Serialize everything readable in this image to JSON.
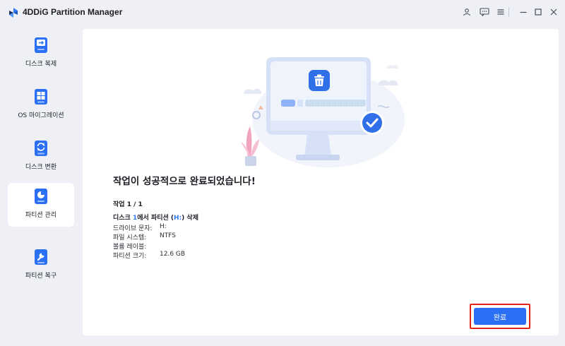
{
  "app": {
    "title": "4DDiG Partition Manager"
  },
  "titlebar": {
    "icons": [
      "user-icon",
      "feedback-icon",
      "menu-icon",
      "minimize-icon",
      "maximize-icon",
      "close-icon"
    ]
  },
  "sidebar": {
    "items": [
      {
        "label": "디스크 복제",
        "icon": "disk-clone-icon",
        "active": false
      },
      {
        "label": "OS 마이그레이션",
        "icon": "os-migration-icon",
        "active": false
      },
      {
        "label": "디스크 변환",
        "icon": "disk-convert-icon",
        "active": false
      },
      {
        "label": "파티션 관리",
        "icon": "partition-manage-icon",
        "active": true
      },
      {
        "label": "파티션 복구",
        "icon": "partition-recovery-icon",
        "active": false
      }
    ]
  },
  "main": {
    "success_title": "작업이 성공적으로 완료되었습니다!",
    "task_count": "작업 1 / 1",
    "operation": {
      "prefix": "디스크 ",
      "disk_num": "1",
      "middle": "에서 파티션 (",
      "drive": "H:",
      "suffix": ") 삭제"
    },
    "details": [
      {
        "label": "드라이브 문자:",
        "value": "H:"
      },
      {
        "label": "파일 시스템:",
        "value": "NTFS"
      },
      {
        "label": "볼륨 레이블:",
        "value": ""
      },
      {
        "label": "파티션 크기:",
        "value": "12.6 GB"
      }
    ],
    "done_label": "완료"
  },
  "colors": {
    "accent": "#2b6ff5",
    "highlight_frame": "#e2231a",
    "success_check": "#2f6fe8"
  }
}
